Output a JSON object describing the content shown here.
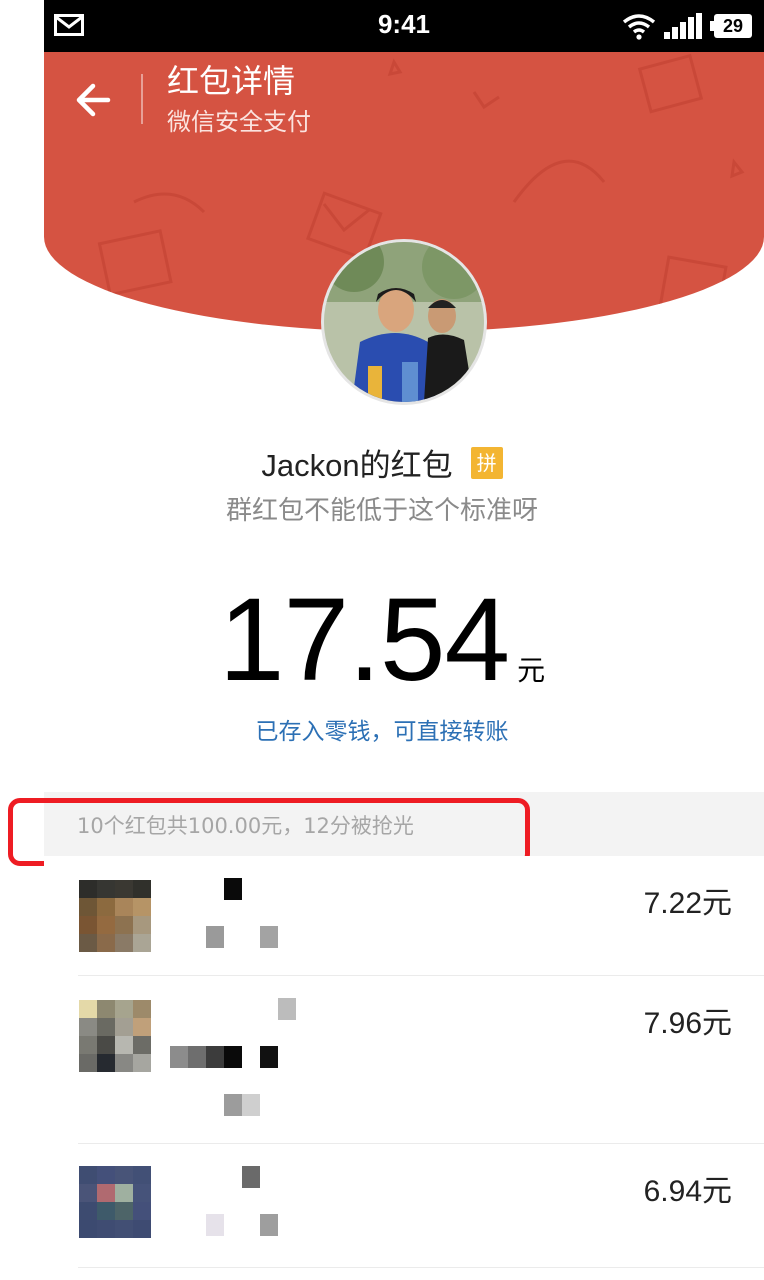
{
  "status_bar": {
    "time": "9:41",
    "battery": "29"
  },
  "header": {
    "title": "红包详情",
    "subtitle": "微信安全支付",
    "accent_color": "#d55342"
  },
  "envelope": {
    "sender": "Jackon的红包",
    "badge": "拼",
    "greeting": "群红包不能低于这个标准呀",
    "amount": "17.54",
    "unit": "元",
    "saved_note": "已存入零钱，可直接转账"
  },
  "summary": "10个红包共100.00元，12分被抢光",
  "recipients": [
    {
      "amount": "7.22元"
    },
    {
      "amount": "7.96元"
    },
    {
      "amount": "6.94元"
    }
  ]
}
